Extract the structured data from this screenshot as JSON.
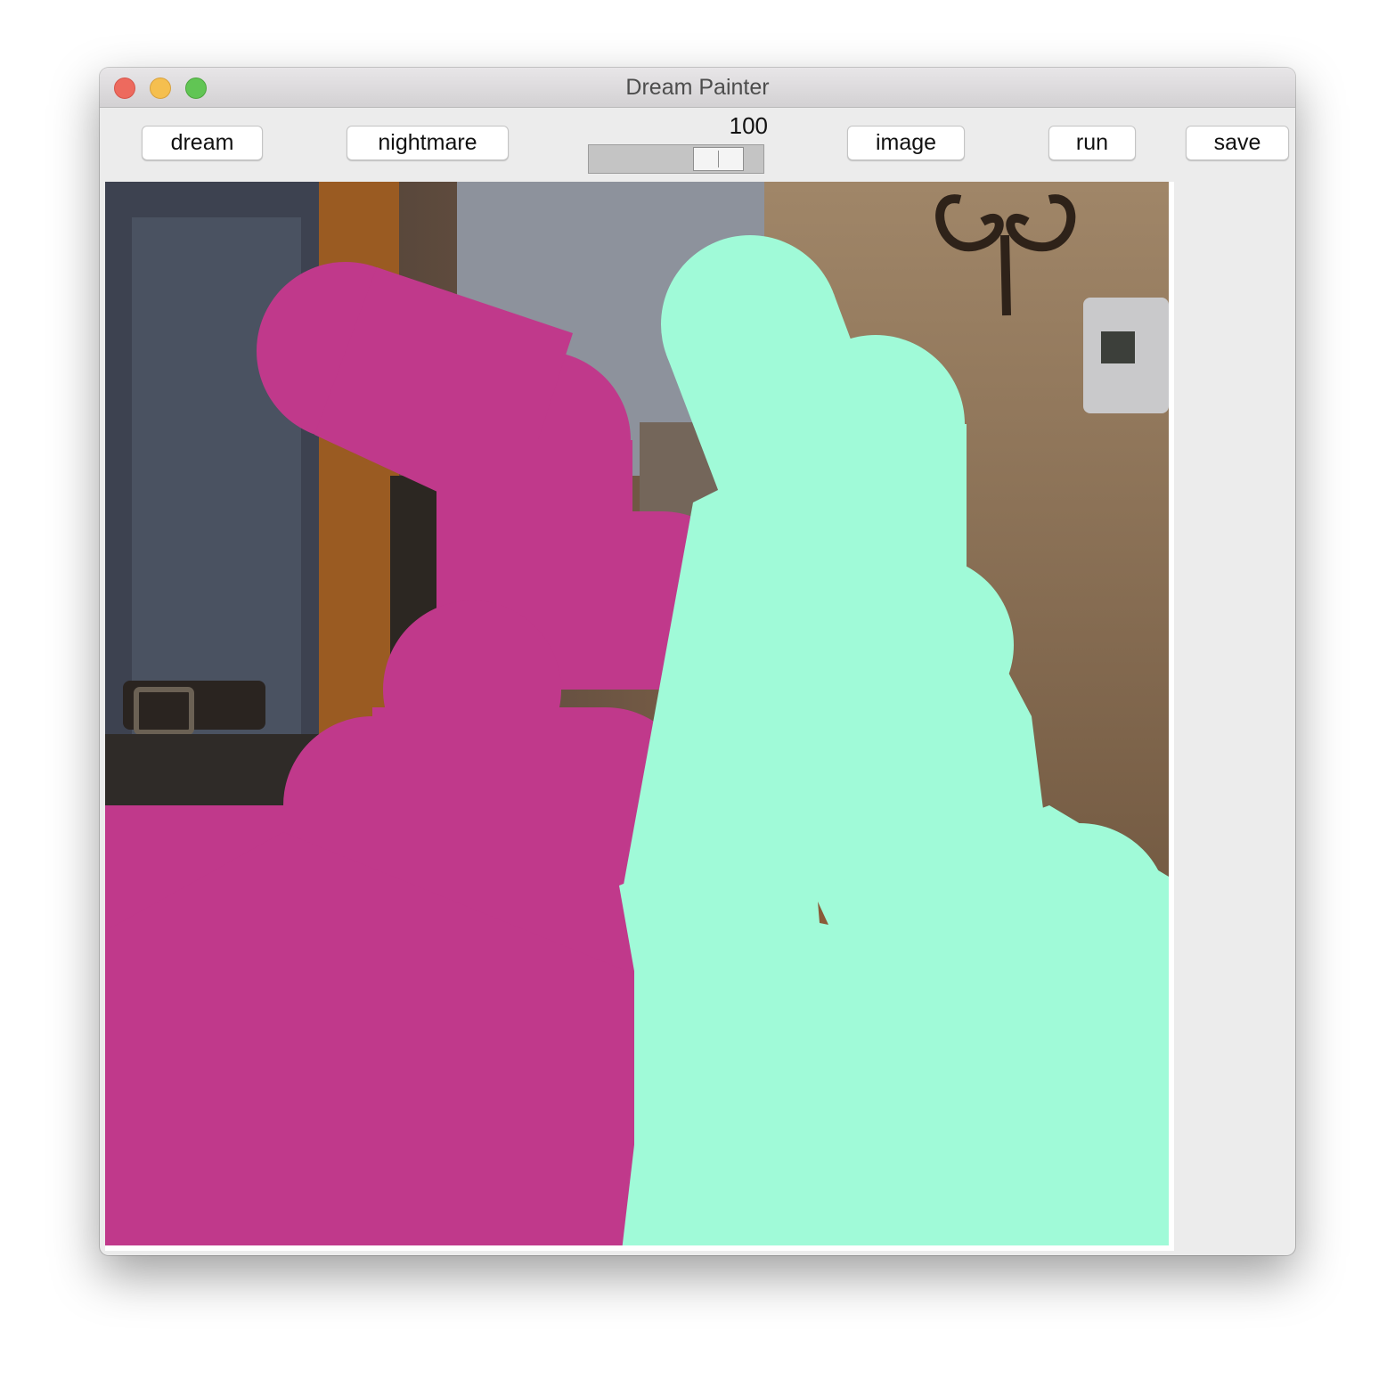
{
  "window": {
    "title": "Dream Painter"
  },
  "toolbar": {
    "dream_label": "dream",
    "nightmare_label": "nightmare",
    "image_label": "image",
    "run_label": "run",
    "save_label": "save"
  },
  "slider": {
    "value": "100",
    "level": 0.85
  },
  "canvas": {
    "brush_colors": {
      "magenta": "#c0398b",
      "mint": "#a0fad8"
    }
  }
}
